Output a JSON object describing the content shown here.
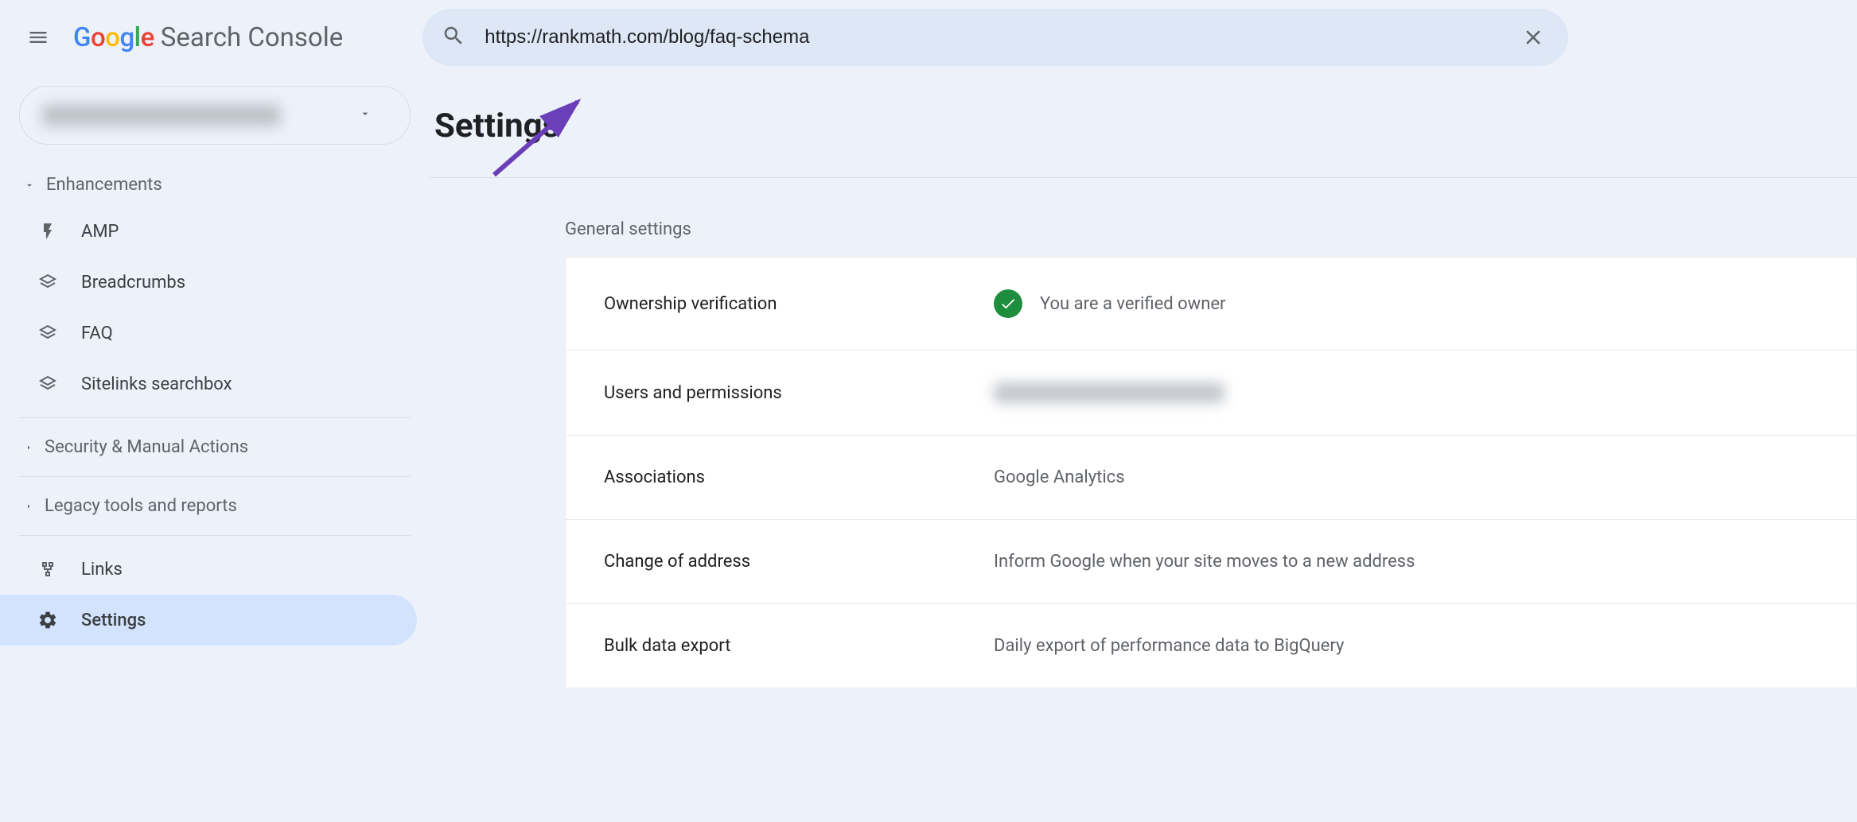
{
  "header": {
    "product_name": "Search Console",
    "search_value": "https://rankmath.com/blog/faq-schema"
  },
  "sidebar": {
    "enhancements_label": "Enhancements",
    "enhancements_items": [
      {
        "icon": "amp",
        "label": "AMP"
      },
      {
        "icon": "breadcrumbs",
        "label": "Breadcrumbs"
      },
      {
        "icon": "faq",
        "label": "FAQ"
      },
      {
        "icon": "sitelinks",
        "label": "Sitelinks searchbox"
      }
    ],
    "security_label": "Security & Manual Actions",
    "legacy_label": "Legacy tools and reports",
    "links_label": "Links",
    "settings_label": "Settings"
  },
  "main": {
    "page_title": "Settings",
    "general_label": "General settings",
    "rows": [
      {
        "label": "Ownership verification",
        "value": "You are a verified owner",
        "check": true,
        "blur": false
      },
      {
        "label": "Users and permissions",
        "value": "",
        "check": false,
        "blur": true
      },
      {
        "label": "Associations",
        "value": "Google Analytics",
        "check": false,
        "blur": false
      },
      {
        "label": "Change of address",
        "value": "Inform Google when your site moves to a new address",
        "check": false,
        "blur": false
      },
      {
        "label": "Bulk data export",
        "value": "Daily export of performance data to BigQuery",
        "check": false,
        "blur": false
      }
    ]
  }
}
